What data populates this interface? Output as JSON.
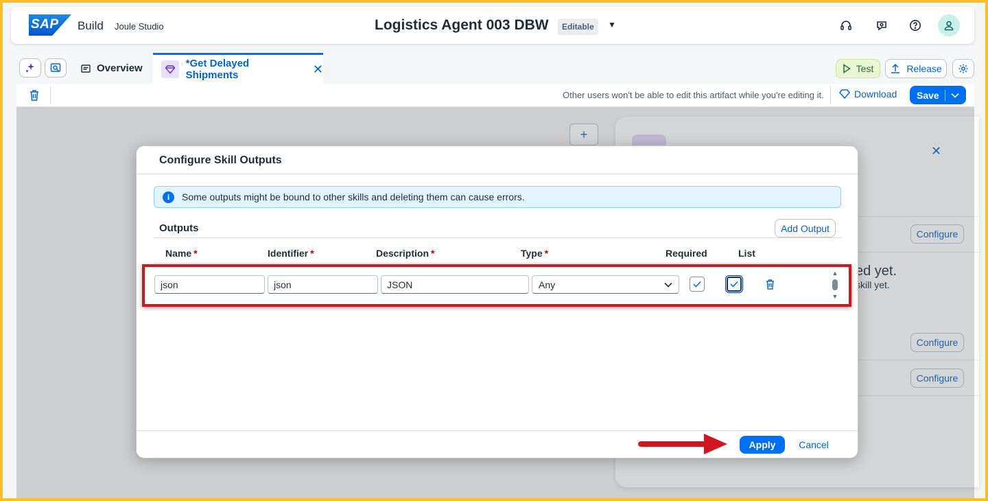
{
  "shell": {
    "logo_text": "SAP",
    "build": "Build",
    "product": "Joule Studio",
    "title": "Logistics Agent 003 DBW",
    "badge": "Editable"
  },
  "tabs": {
    "overview": "Overview",
    "active": "*Get Delayed Shipments"
  },
  "actions": {
    "test": "Test",
    "release": "Release",
    "download": "Download",
    "save": "Save"
  },
  "toolbar": {
    "info": "Other users won't be able to edit this artifact while you're editing it."
  },
  "side_panel": {
    "configure_label": "Configure",
    "big_text": "ed yet.",
    "small_text": "skill yet."
  },
  "dialog": {
    "title": "Configure Skill Outputs",
    "info_message": "Some outputs might be bound to other skills and deleting them can cause errors.",
    "outputs_label": "Outputs",
    "add_output": "Add Output",
    "columns": {
      "name": "Name",
      "identifier": "Identifier",
      "description": "Description",
      "type": "Type",
      "required": "Required",
      "list": "List",
      "required_marker": "*"
    },
    "rows": [
      {
        "name": "json",
        "identifier": "json",
        "description": "JSON",
        "type": "Any",
        "required": true,
        "list": true
      }
    ],
    "apply": "Apply",
    "cancel": "Cancel"
  },
  "colors": {
    "accent": "#0070f2",
    "highlight": "#d2161e",
    "frame": "#f6c026"
  }
}
